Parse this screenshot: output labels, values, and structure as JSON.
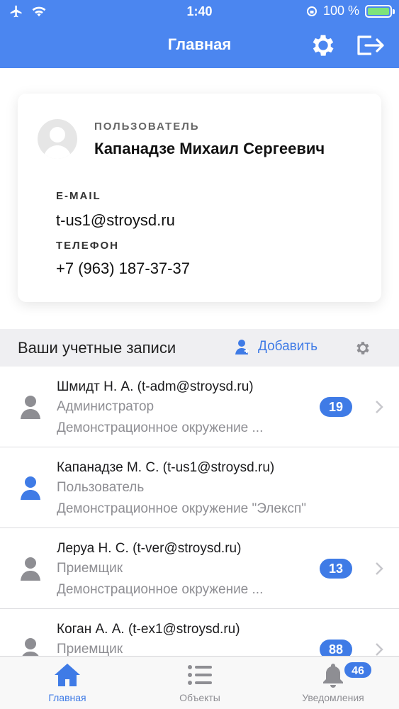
{
  "status_bar": {
    "time": "1:40",
    "battery": "100 %",
    "battery_level": 1.0
  },
  "header": {
    "title": "Главная"
  },
  "profile": {
    "user_label": "ПОЛЬЗОВАТЕЛЬ",
    "user_name": "Капанадзе Михаил Сергеевич",
    "email_label": "E-MAIL",
    "email": "t-us1@stroysd.ru",
    "phone_label": "ТЕЛЕФОН",
    "phone": "+7 (963) 187-37-37"
  },
  "accounts": {
    "title": "Ваши учетные записи",
    "add_label": "Добавить",
    "items": [
      {
        "name": "Шмидт Н. А. (t-adm@stroysd.ru)",
        "role": "Администратор",
        "env": "Демонстрационное окружение ...",
        "badge": "19",
        "active": false
      },
      {
        "name": "Капанадзе М. С. (t-us1@stroysd.ru)",
        "role": "Пользователь",
        "env": "Демонстрационное окружение \"Элексп\"",
        "badge": "",
        "active": true
      },
      {
        "name": "Леруа Н. С. (t-ver@stroysd.ru)",
        "role": "Приемщик",
        "env": "Демонстрационное окружение ...",
        "badge": "13",
        "active": false
      },
      {
        "name": "Коган А. А. (t-ex1@stroysd.ru)",
        "role": "Приемщик",
        "env": "",
        "badge": "88",
        "active": false
      }
    ]
  },
  "tabbar": {
    "home": "Главная",
    "objects": "Объекты",
    "notifications": "Уведомления",
    "notifications_badge": "46"
  },
  "colors": {
    "accent": "#3f7be6",
    "header_bg": "#4b86f0",
    "battery": "#7ee37a"
  }
}
